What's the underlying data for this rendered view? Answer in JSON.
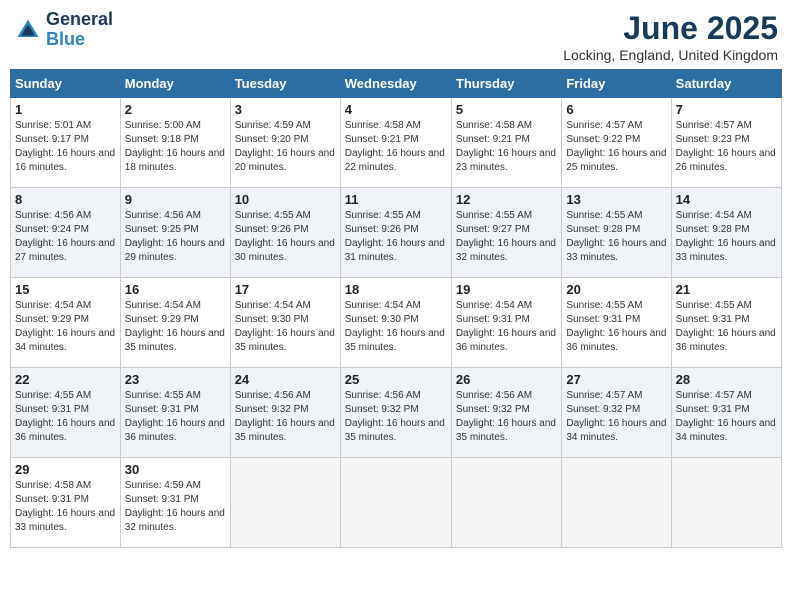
{
  "header": {
    "logo_line1": "General",
    "logo_line2": "Blue",
    "month": "June 2025",
    "location": "Locking, England, United Kingdom"
  },
  "weekdays": [
    "Sunday",
    "Monday",
    "Tuesday",
    "Wednesday",
    "Thursday",
    "Friday",
    "Saturday"
  ],
  "weeks": [
    [
      {
        "day": "1",
        "sunrise": "Sunrise: 5:01 AM",
        "sunset": "Sunset: 9:17 PM",
        "daylight": "Daylight: 16 hours and 16 minutes."
      },
      {
        "day": "2",
        "sunrise": "Sunrise: 5:00 AM",
        "sunset": "Sunset: 9:18 PM",
        "daylight": "Daylight: 16 hours and 18 minutes."
      },
      {
        "day": "3",
        "sunrise": "Sunrise: 4:59 AM",
        "sunset": "Sunset: 9:20 PM",
        "daylight": "Daylight: 16 hours and 20 minutes."
      },
      {
        "day": "4",
        "sunrise": "Sunrise: 4:58 AM",
        "sunset": "Sunset: 9:21 PM",
        "daylight": "Daylight: 16 hours and 22 minutes."
      },
      {
        "day": "5",
        "sunrise": "Sunrise: 4:58 AM",
        "sunset": "Sunset: 9:21 PM",
        "daylight": "Daylight: 16 hours and 23 minutes."
      },
      {
        "day": "6",
        "sunrise": "Sunrise: 4:57 AM",
        "sunset": "Sunset: 9:22 PM",
        "daylight": "Daylight: 16 hours and 25 minutes."
      },
      {
        "day": "7",
        "sunrise": "Sunrise: 4:57 AM",
        "sunset": "Sunset: 9:23 PM",
        "daylight": "Daylight: 16 hours and 26 minutes."
      }
    ],
    [
      {
        "day": "8",
        "sunrise": "Sunrise: 4:56 AM",
        "sunset": "Sunset: 9:24 PM",
        "daylight": "Daylight: 16 hours and 27 minutes."
      },
      {
        "day": "9",
        "sunrise": "Sunrise: 4:56 AM",
        "sunset": "Sunset: 9:25 PM",
        "daylight": "Daylight: 16 hours and 29 minutes."
      },
      {
        "day": "10",
        "sunrise": "Sunrise: 4:55 AM",
        "sunset": "Sunset: 9:26 PM",
        "daylight": "Daylight: 16 hours and 30 minutes."
      },
      {
        "day": "11",
        "sunrise": "Sunrise: 4:55 AM",
        "sunset": "Sunset: 9:26 PM",
        "daylight": "Daylight: 16 hours and 31 minutes."
      },
      {
        "day": "12",
        "sunrise": "Sunrise: 4:55 AM",
        "sunset": "Sunset: 9:27 PM",
        "daylight": "Daylight: 16 hours and 32 minutes."
      },
      {
        "day": "13",
        "sunrise": "Sunrise: 4:55 AM",
        "sunset": "Sunset: 9:28 PM",
        "daylight": "Daylight: 16 hours and 33 minutes."
      },
      {
        "day": "14",
        "sunrise": "Sunrise: 4:54 AM",
        "sunset": "Sunset: 9:28 PM",
        "daylight": "Daylight: 16 hours and 33 minutes."
      }
    ],
    [
      {
        "day": "15",
        "sunrise": "Sunrise: 4:54 AM",
        "sunset": "Sunset: 9:29 PM",
        "daylight": "Daylight: 16 hours and 34 minutes."
      },
      {
        "day": "16",
        "sunrise": "Sunrise: 4:54 AM",
        "sunset": "Sunset: 9:29 PM",
        "daylight": "Daylight: 16 hours and 35 minutes."
      },
      {
        "day": "17",
        "sunrise": "Sunrise: 4:54 AM",
        "sunset": "Sunset: 9:30 PM",
        "daylight": "Daylight: 16 hours and 35 minutes."
      },
      {
        "day": "18",
        "sunrise": "Sunrise: 4:54 AM",
        "sunset": "Sunset: 9:30 PM",
        "daylight": "Daylight: 16 hours and 35 minutes."
      },
      {
        "day": "19",
        "sunrise": "Sunrise: 4:54 AM",
        "sunset": "Sunset: 9:31 PM",
        "daylight": "Daylight: 16 hours and 36 minutes."
      },
      {
        "day": "20",
        "sunrise": "Sunrise: 4:55 AM",
        "sunset": "Sunset: 9:31 PM",
        "daylight": "Daylight: 16 hours and 36 minutes."
      },
      {
        "day": "21",
        "sunrise": "Sunrise: 4:55 AM",
        "sunset": "Sunset: 9:31 PM",
        "daylight": "Daylight: 16 hours and 36 minutes."
      }
    ],
    [
      {
        "day": "22",
        "sunrise": "Sunrise: 4:55 AM",
        "sunset": "Sunset: 9:31 PM",
        "daylight": "Daylight: 16 hours and 36 minutes."
      },
      {
        "day": "23",
        "sunrise": "Sunrise: 4:55 AM",
        "sunset": "Sunset: 9:31 PM",
        "daylight": "Daylight: 16 hours and 36 minutes."
      },
      {
        "day": "24",
        "sunrise": "Sunrise: 4:56 AM",
        "sunset": "Sunset: 9:32 PM",
        "daylight": "Daylight: 16 hours and 35 minutes."
      },
      {
        "day": "25",
        "sunrise": "Sunrise: 4:56 AM",
        "sunset": "Sunset: 9:32 PM",
        "daylight": "Daylight: 16 hours and 35 minutes."
      },
      {
        "day": "26",
        "sunrise": "Sunrise: 4:56 AM",
        "sunset": "Sunset: 9:32 PM",
        "daylight": "Daylight: 16 hours and 35 minutes."
      },
      {
        "day": "27",
        "sunrise": "Sunrise: 4:57 AM",
        "sunset": "Sunset: 9:32 PM",
        "daylight": "Daylight: 16 hours and 34 minutes."
      },
      {
        "day": "28",
        "sunrise": "Sunrise: 4:57 AM",
        "sunset": "Sunset: 9:31 PM",
        "daylight": "Daylight: 16 hours and 34 minutes."
      }
    ],
    [
      {
        "day": "29",
        "sunrise": "Sunrise: 4:58 AM",
        "sunset": "Sunset: 9:31 PM",
        "daylight": "Daylight: 16 hours and 33 minutes."
      },
      {
        "day": "30",
        "sunrise": "Sunrise: 4:59 AM",
        "sunset": "Sunset: 9:31 PM",
        "daylight": "Daylight: 16 hours and 32 minutes."
      },
      null,
      null,
      null,
      null,
      null
    ]
  ]
}
